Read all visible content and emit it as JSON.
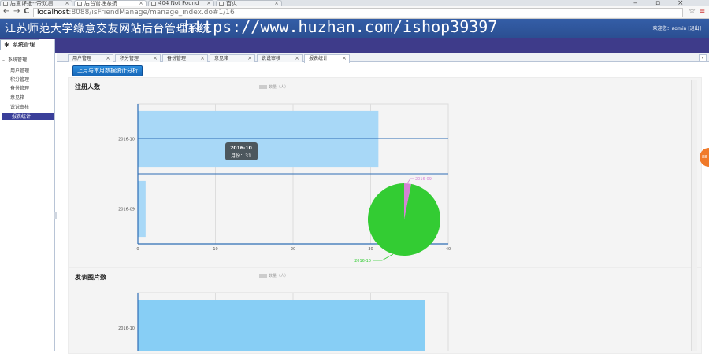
{
  "browser": {
    "tabs": [
      {
        "label": "后置详细--帝奴测",
        "active": false
      },
      {
        "label": "后台管理系统",
        "active": true
      },
      {
        "label": "404 Not Found",
        "active": false
      },
      {
        "label": "首页",
        "active": false
      }
    ],
    "url_host": "localhost",
    "url_path": ":8088/isFriendManage/manage_index.do#1/16"
  },
  "header": {
    "title": "江苏师范大学缘意交友网站后台管理系统",
    "watermark": "https://www.huzhan.com/ishop39397",
    "welcome": "欢迎您：admin [退出]"
  },
  "sidebar": {
    "menu_tab": "系统管理",
    "group_label": "系统管理",
    "items": [
      {
        "label": "用户管理",
        "active": false
      },
      {
        "label": "积分管理",
        "active": false
      },
      {
        "label": "备份管理",
        "active": false
      },
      {
        "label": "意见箱",
        "active": false
      },
      {
        "label": "说说审核",
        "active": false
      },
      {
        "label": "报表统计",
        "active": true
      }
    ]
  },
  "content_tabs": [
    {
      "label": "用户管理",
      "active": false
    },
    {
      "label": "积分管理",
      "active": false
    },
    {
      "label": "备份管理",
      "active": false
    },
    {
      "label": "意见箱",
      "active": false
    },
    {
      "label": "说说审核",
      "active": false
    },
    {
      "label": "报表统计",
      "active": true
    }
  ],
  "toolbar": {
    "stats_button": "上月与本月数据统计分析"
  },
  "charts": {
    "panel1_title": "注册人数",
    "panel1_legend": "数量（人）",
    "panel2_title": "发表图片数",
    "panel2_legend": "数量（人）",
    "tooltip_title": "2016-10",
    "tooltip_line": "月份：31",
    "badge": "88"
  },
  "chart_data": [
    {
      "type": "bar",
      "orientation": "horizontal",
      "title": "注册人数",
      "categories": [
        "2016-10",
        "2016-09"
      ],
      "series": [
        {
          "name": "数量（人）",
          "values": [
            31,
            1
          ]
        }
      ],
      "xlim": [
        0,
        40
      ],
      "xticks": [
        0,
        10,
        20,
        30,
        40
      ],
      "grid": true,
      "legend": "top-center",
      "color": "#a8d8f7"
    },
    {
      "type": "pie",
      "labels": [
        "2016-09",
        "2016-10"
      ],
      "values": [
        1,
        31
      ],
      "colors": [
        "#d583d6",
        "#33cc33"
      ]
    },
    {
      "type": "bar",
      "orientation": "horizontal",
      "title": "发表图片数",
      "categories": [
        "2016-10"
      ],
      "series": [
        {
          "name": "数量（人）",
          "values": [
            37
          ]
        }
      ],
      "xlim": [
        0,
        40
      ],
      "grid": true,
      "legend": "top-center",
      "color": "#87cef5"
    }
  ]
}
